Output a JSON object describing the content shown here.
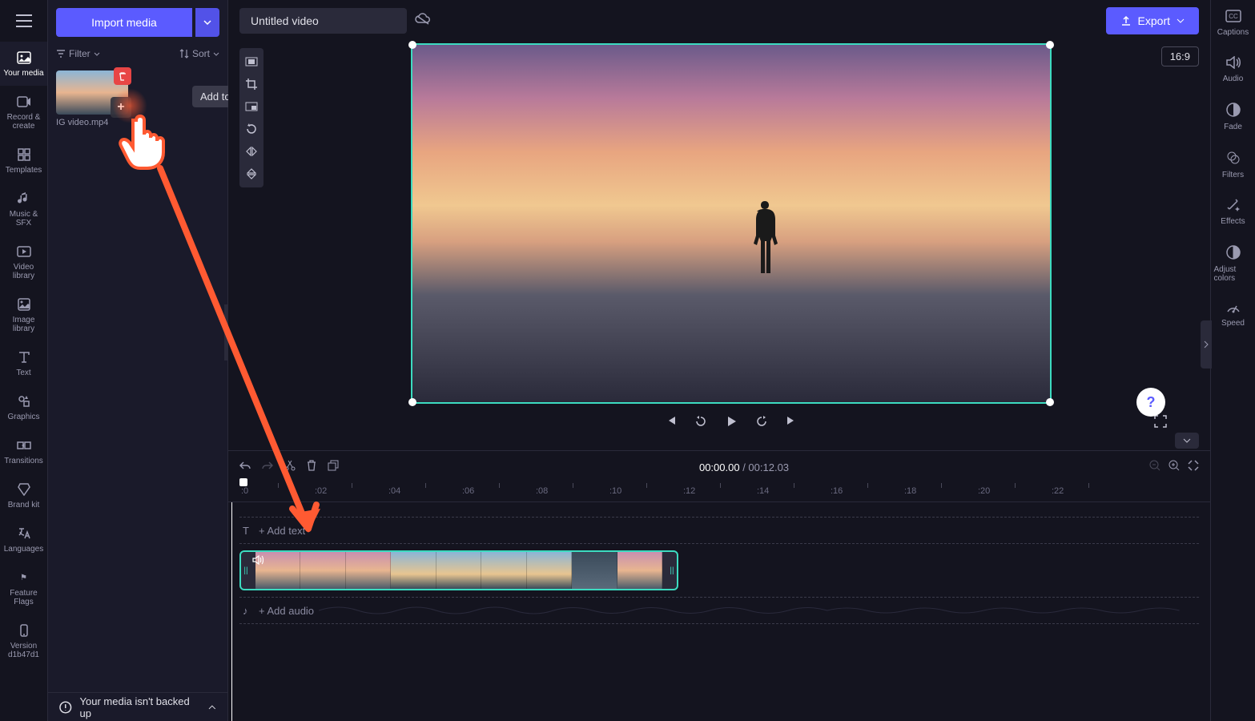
{
  "hamburger": {
    "label": "Menu"
  },
  "leftRail": [
    {
      "label": "Your media",
      "icon": "media"
    },
    {
      "label": "Record & create",
      "icon": "record"
    },
    {
      "label": "Templates",
      "icon": "templates"
    },
    {
      "label": "Music & SFX",
      "icon": "music"
    },
    {
      "label": "Video library",
      "icon": "video"
    },
    {
      "label": "Image library",
      "icon": "image"
    },
    {
      "label": "Text",
      "icon": "text"
    },
    {
      "label": "Graphics",
      "icon": "graphics"
    },
    {
      "label": "Transitions",
      "icon": "transitions"
    },
    {
      "label": "Brand kit",
      "icon": "brand"
    },
    {
      "label": "Languages",
      "icon": "languages"
    },
    {
      "label": "Feature Flags",
      "icon": "flags"
    },
    {
      "label": "Version d1b47d1",
      "icon": "version"
    }
  ],
  "importButton": "Import media",
  "filterLabel": "Filter",
  "sortLabel": "Sort",
  "mediaItem": {
    "name": "IG video.mp4"
  },
  "tooltip": "Add to timeline",
  "projectTitle": "Untitled video",
  "exportLabel": "Export",
  "aspectRatio": "16:9",
  "playback": {
    "current": "00:00.00",
    "separator": " / ",
    "duration": "00:12.03"
  },
  "ruler": [
    ":0",
    ":02",
    ":04",
    ":06",
    ":08",
    ":10",
    ":12",
    ":14",
    ":16",
    ":18",
    ":20",
    ":22"
  ],
  "rulerBase": 16,
  "rulerStep": 92,
  "trackAddText": "+ Add text",
  "trackAddAudio": "+ Add audio",
  "rightRail": [
    {
      "label": "Captions",
      "icon": "captions"
    },
    {
      "label": "Audio",
      "icon": "audio"
    },
    {
      "label": "Fade",
      "icon": "fade"
    },
    {
      "label": "Filters",
      "icon": "filters"
    },
    {
      "label": "Effects",
      "icon": "effects"
    },
    {
      "label": "Adjust colors",
      "icon": "adjust"
    },
    {
      "label": "Speed",
      "icon": "speed"
    }
  ],
  "backupMessage": "Your media isn't backed up",
  "helpLabel": "?"
}
